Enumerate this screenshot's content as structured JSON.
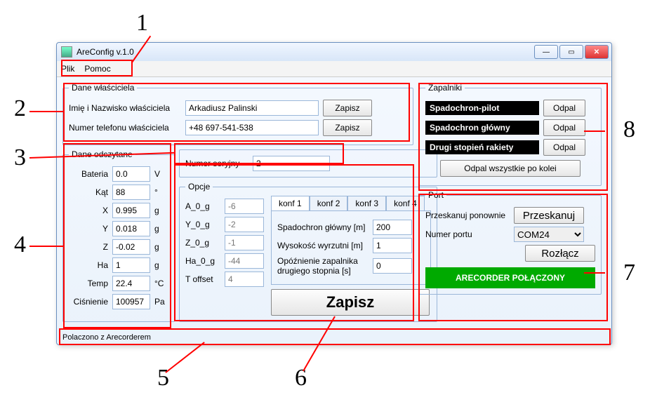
{
  "window": {
    "title": "AreConfig v.1.0"
  },
  "menu": {
    "file": "Plik",
    "help": "Pomoc"
  },
  "owner": {
    "legend": "Dane właściciela",
    "name_label": "Imię i Nazwisko właściciela",
    "name_value": "Arkadiusz Palinski",
    "phone_label": "Numer telefonu właściciela",
    "phone_value": "+48 697-541-538",
    "save": "Zapisz"
  },
  "serial": {
    "label": "Numer seryjny",
    "value": "2"
  },
  "readings": {
    "legend": "Dane odczytane",
    "rows": [
      {
        "label": "Bateria",
        "value": "0.0",
        "unit": "V"
      },
      {
        "label": "Kąt",
        "value": "88",
        "unit": "°"
      },
      {
        "label": "X",
        "value": "0.995",
        "unit": "g"
      },
      {
        "label": "Y",
        "value": "0.018",
        "unit": "g"
      },
      {
        "label": "Z",
        "value": "-0.02",
        "unit": "g"
      },
      {
        "label": "Ha",
        "value": "1",
        "unit": "g"
      },
      {
        "label": "Temp",
        "value": "22.4",
        "unit": "°C"
      },
      {
        "label": "Ciśnienie",
        "value": "100957",
        "unit": "Pa"
      }
    ]
  },
  "options": {
    "legend": "Opcje",
    "cal": [
      {
        "label": "A_0_g",
        "value": "-6"
      },
      {
        "label": "Y_0_g",
        "value": "-2"
      },
      {
        "label": "Z_0_g",
        "value": "-1"
      },
      {
        "label": "Ha_0_g",
        "value": "-44"
      },
      {
        "label": "T offset",
        "value": "4"
      }
    ],
    "tabs": [
      "konf 1",
      "konf 2",
      "konf 3",
      "konf 4"
    ],
    "active_tab": 0,
    "conf_rows": [
      {
        "label": "Spadochron główny [m]",
        "value": "200"
      },
      {
        "label": "Wysokość wyrzutni [m]",
        "value": "1"
      },
      {
        "label": "Opóźnienie zapalnika drugiego stopnia [s]",
        "value": "0"
      }
    ],
    "big_save": "Zapisz"
  },
  "igniters": {
    "legend": "Zapalniki",
    "rows": [
      {
        "name": "Spadochron-pilot",
        "fire": "Odpal"
      },
      {
        "name": "Spadochron główny",
        "fire": "Odpal"
      },
      {
        "name": "Drugi stopień rakiety",
        "fire": "Odpal"
      }
    ],
    "fire_all": "Odpal wszystkie po kolei"
  },
  "port": {
    "legend": "Port",
    "scan_label": "Przeskanuj ponownie",
    "scan_button": "Przeskanuj",
    "number_label": "Numer portu",
    "selected": "COM24",
    "disconnect": "Rozłącz"
  },
  "status": {
    "connected": "ARECORDER POŁĄCZONY",
    "bar": "Polaczono z Arecorderem"
  },
  "annotations": [
    "1",
    "2",
    "3",
    "4",
    "5",
    "6",
    "7",
    "8"
  ]
}
